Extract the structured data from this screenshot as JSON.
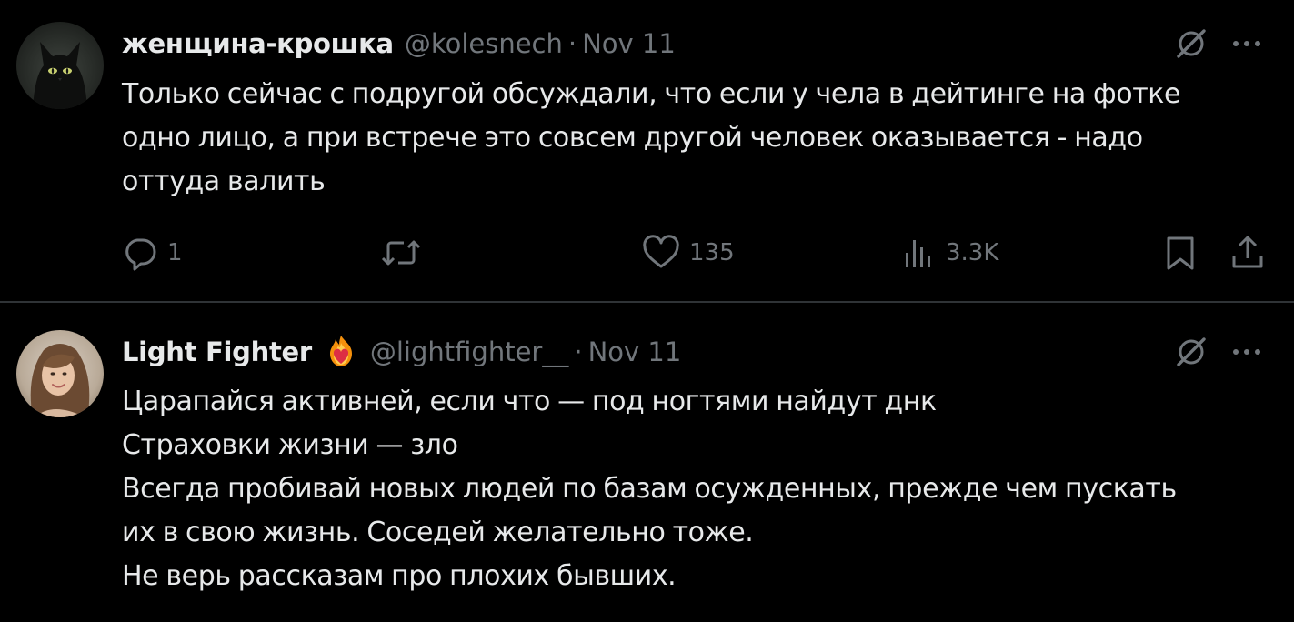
{
  "tweets": [
    {
      "display_name": "женщина-крошка",
      "handle": "@kolesnech",
      "separator": "·",
      "date": "Nov 11",
      "body_lines": [
        "Только сейчас с подругой обсуждали, что если у чела в дейтинге на фотке",
        "одно лицо, а при встрече это совсем другой человек оказывается - надо",
        "оттуда валить"
      ],
      "actions": {
        "replies": "1",
        "retweets": "",
        "likes": "135",
        "views": "3.3K"
      },
      "avatar_icon": "black-cat-avatar"
    },
    {
      "display_name": "Light Fighter",
      "badge_icon": "fire-heart-emoji-icon",
      "handle": "@lightfighter__",
      "separator": "·",
      "date": "Nov 11",
      "body_lines": [
        "Царапайся активней, если что — под ногтями найдут днк",
        "Страховки жизни — зло",
        "Всегда пробивай новых людей по базам осужденных, прежде чем пускать",
        "их в свою жизнь. Соседей желательно тоже.",
        "Не верь рассказам про плохих бывших."
      ],
      "avatar_icon": "woman-portrait-avatar"
    }
  ],
  "colors": {
    "background": "#000000",
    "text_primary": "#e7e9ea",
    "text_secondary": "#71767b",
    "divider": "#2f3336"
  }
}
